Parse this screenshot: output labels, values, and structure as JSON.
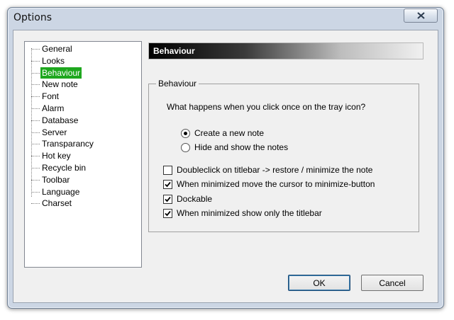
{
  "window": {
    "title": "Options"
  },
  "tree": {
    "items": [
      {
        "label": "General",
        "selected": false
      },
      {
        "label": "Looks",
        "selected": false
      },
      {
        "label": "Behaviour",
        "selected": true
      },
      {
        "label": "New note",
        "selected": false
      },
      {
        "label": "Font",
        "selected": false
      },
      {
        "label": "Alarm",
        "selected": false
      },
      {
        "label": "Database",
        "selected": false
      },
      {
        "label": "Server",
        "selected": false
      },
      {
        "label": "Transparancy",
        "selected": false
      },
      {
        "label": "Hot key",
        "selected": false
      },
      {
        "label": "Recycle bin",
        "selected": false
      },
      {
        "label": "Toolbar",
        "selected": false
      },
      {
        "label": "Language",
        "selected": false
      },
      {
        "label": "Charset",
        "selected": false
      }
    ],
    "selected_color": "#1ea71e"
  },
  "panel": {
    "header": "Behaviour",
    "group_title": "Behaviour",
    "question": "What happens when you click once on the tray icon?",
    "radios": [
      {
        "label": "Create a new note",
        "checked": true
      },
      {
        "label": "Hide and show the notes",
        "checked": false
      }
    ],
    "checkboxes": [
      {
        "label": "Doubleclick on titlebar -> restore / minimize the note",
        "checked": false
      },
      {
        "label": "When minimized move the cursor to minimize-button",
        "checked": true
      },
      {
        "label": "Dockable",
        "checked": true
      },
      {
        "label": "When minimized show only the titlebar",
        "checked": true
      }
    ]
  },
  "buttons": {
    "ok": "OK",
    "cancel": "Cancel"
  },
  "icons": {
    "close": "close-icon",
    "check": "checkmark-icon"
  }
}
